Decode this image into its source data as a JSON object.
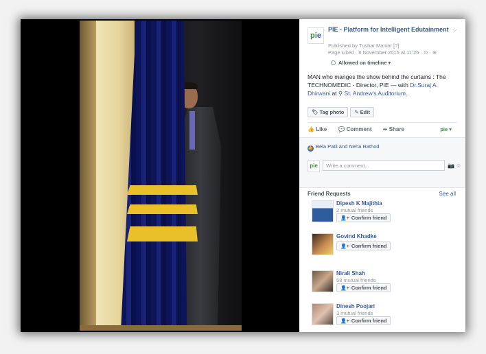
{
  "post": {
    "page_name": "PIE - Platform for Intelligent Edutainment",
    "published_by": "Published by Tushar Maniar [?]",
    "page_liked": "Page Liked · 8 November 2015 at 11:26 · ⊙ · ⊕",
    "timeline_label": "Allowed on timeline ▾",
    "caption_text": "MAN who manges the show behind the curtains : The TECHNOMEDIC - Director, PIE — with ",
    "tagged_person": "Dr.Suraj A. Dhirwani",
    "at_text": " at ",
    "location": "St. Andrew's Auditorium",
    "period": "."
  },
  "buttons": {
    "tag_photo": "Tag photo",
    "edit": "Edit"
  },
  "actions": {
    "like": "Like",
    "comment": "Comment",
    "share": "Share"
  },
  "reactions": {
    "likers": "Bela Patil and Neha Rathod"
  },
  "comment_box": {
    "placeholder": "Write a comment..."
  },
  "friend_requests": {
    "title": "Friend Requests",
    "see_all": "See all",
    "confirm_label": "Confirm friend",
    "items": [
      {
        "name": "Dipesh K Majithia",
        "mutual": "2 mutual friends"
      },
      {
        "name": "Govind Khadke",
        "mutual": ""
      },
      {
        "name": "Nirali Shah",
        "mutual": "58 mutual friends"
      },
      {
        "name": "Dinesh Poojari",
        "mutual": "3 mutual friends"
      }
    ]
  },
  "colors": {
    "link": "#365899",
    "curtain_blue": "#182378",
    "curtain_gold": "#e9c02a",
    "brand_green": "#3c8c3c"
  },
  "icons": [
    "chevron-down-icon",
    "globe-icon",
    "tag-icon",
    "pencil-icon",
    "thumbs-up-icon",
    "comment-icon",
    "share-icon",
    "camera-icon",
    "emoji-icon",
    "add-friend-icon",
    "location-pin-icon"
  ]
}
